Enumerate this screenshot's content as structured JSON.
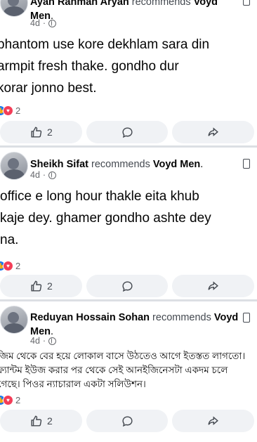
{
  "posts": [
    {
      "author": "Ayan Rahman Aryan",
      "verb": "recommends",
      "page": "Voyd Men",
      "time": "4d",
      "text": "phantom use kore dekhlam sara din\narmpit fresh thake. gondho dur\nkorar jonno best.",
      "reaction_count": "2",
      "like_count": "2"
    },
    {
      "author": "Sheikh Sifat",
      "verb": "recommends",
      "page": "Voyd Men",
      "time": "4d",
      "text": "office e long hour thakle eita khub\nkaje dey. ghamer gondho ashte dey\nna.",
      "reaction_count": "2",
      "like_count": "2"
    },
    {
      "author": "Reduyan Hossain Sohan",
      "verb": "recommends",
      "page": "Voyd Men",
      "time": "4d",
      "text": "জিম থেকে বের হয়ে লোকাল বাসে উঠতেও আগে ইতস্তত লাগতো।\nফ্যান্টম ইউজ করার পর থেকে সেই আনইজিনেসটা একদম চলে\nগেছে। পিওর ন্যাচারাল একটা সলিউশন।",
      "reaction_count": "2",
      "like_count": "2"
    }
  ],
  "icons": {
    "like": "thumbs-up-icon",
    "comment": "comment-bubble-icon",
    "share": "share-arrow-icon",
    "flag": "bookmark-flag-icon",
    "privacy": "globe-icon"
  },
  "colors": {
    "like_reaction": "#1877f2",
    "love_reaction": "#f33e58",
    "button_bg": "#f0f2f5"
  }
}
